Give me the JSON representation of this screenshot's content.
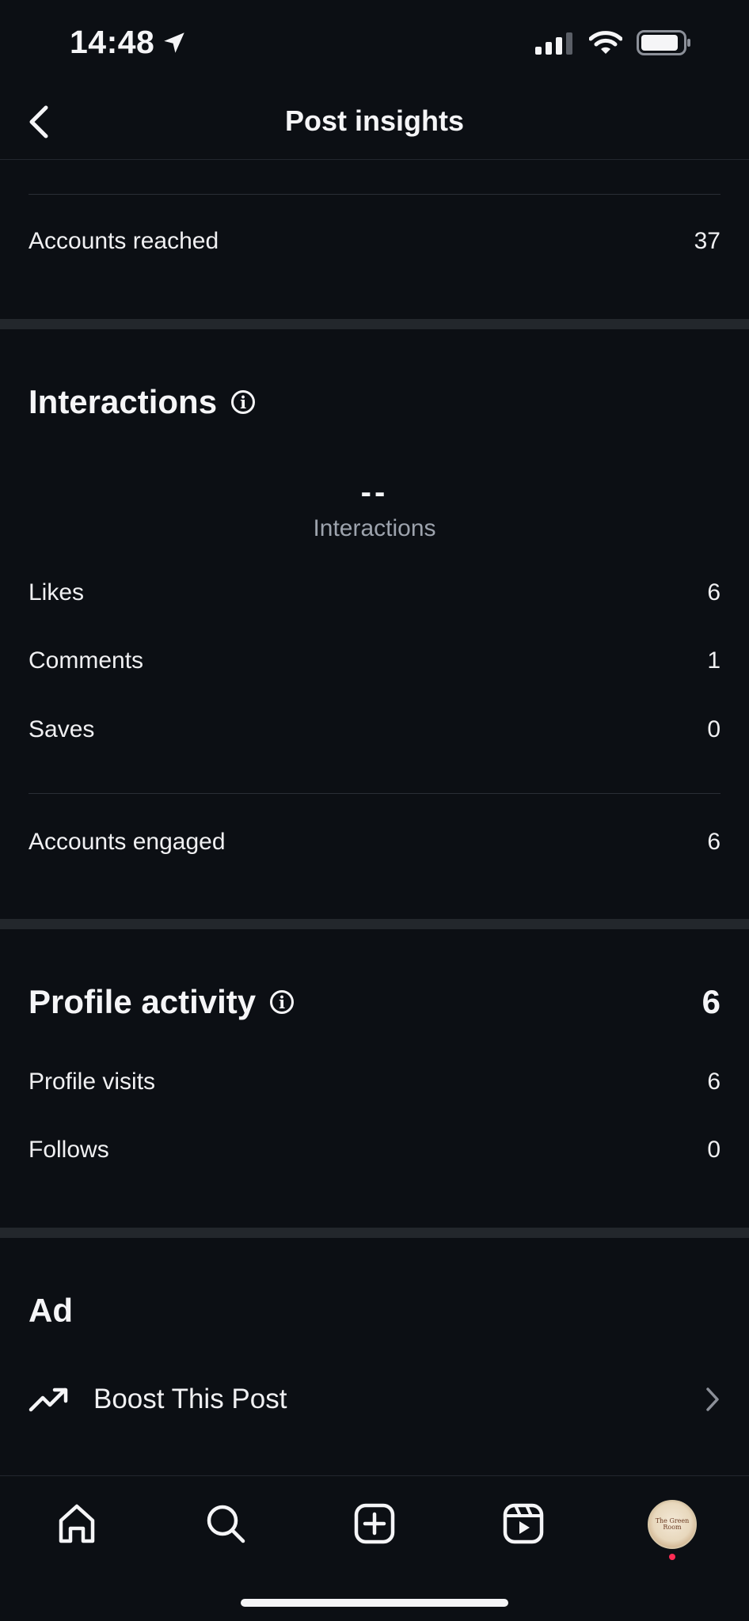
{
  "status_bar": {
    "time": "14:48"
  },
  "header": {
    "title": "Post insights"
  },
  "reach": {
    "accounts_reached_label": "Accounts reached",
    "accounts_reached_value": "37"
  },
  "interactions": {
    "title": "Interactions",
    "total_value": "--",
    "total_label": "Interactions",
    "rows": [
      {
        "label": "Likes",
        "value": "6"
      },
      {
        "label": "Comments",
        "value": "1"
      },
      {
        "label": "Saves",
        "value": "0"
      }
    ],
    "accounts_engaged_label": "Accounts engaged",
    "accounts_engaged_value": "6"
  },
  "profile_activity": {
    "title": "Profile activity",
    "total": "6",
    "rows": [
      {
        "label": "Profile visits",
        "value": "6"
      },
      {
        "label": "Follows",
        "value": "0"
      }
    ]
  },
  "ad": {
    "title": "Ad",
    "boost_label": "Boost This Post"
  },
  "tabbar": {
    "items": [
      "home-icon",
      "search-icon",
      "create-icon",
      "reels-icon",
      "profile-avatar"
    ],
    "avatar_text": "The Green Room"
  },
  "colors": {
    "background": "#0c0f14",
    "section_separator": "#23272c",
    "secondary_text": "#9da3ad",
    "notification_dot": "#ff2d55"
  }
}
